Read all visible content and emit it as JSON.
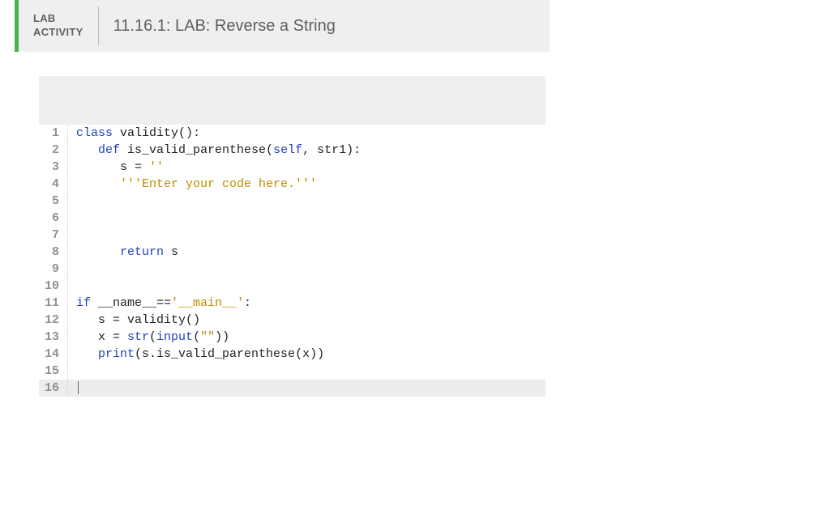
{
  "header": {
    "badge_line1": "LAB",
    "badge_line2": "ACTIVITY",
    "title": "11.16.1: LAB: Reverse a String"
  },
  "editor": {
    "lines": [
      {
        "n": 1,
        "hl": false,
        "tokens": [
          {
            "t": "class ",
            "c": "tok-kw"
          },
          {
            "t": "validity():",
            "c": "tok-name"
          }
        ]
      },
      {
        "n": 2,
        "hl": false,
        "tokens": [
          {
            "t": "   ",
            "c": ""
          },
          {
            "t": "def ",
            "c": "tok-kw"
          },
          {
            "t": "is_valid_parenthese(",
            "c": "tok-name"
          },
          {
            "t": "self",
            "c": "tok-self"
          },
          {
            "t": ", str1):",
            "c": "tok-name"
          }
        ]
      },
      {
        "n": 3,
        "hl": false,
        "tokens": [
          {
            "t": "      s = ",
            "c": "tok-var"
          },
          {
            "t": "''",
            "c": "tok-str"
          }
        ]
      },
      {
        "n": 4,
        "hl": false,
        "tokens": [
          {
            "t": "      ",
            "c": ""
          },
          {
            "t": "'''Enter your code here.'''",
            "c": "tok-str"
          }
        ]
      },
      {
        "n": 5,
        "hl": false,
        "tokens": [
          {
            "t": "",
            "c": ""
          }
        ]
      },
      {
        "n": 6,
        "hl": false,
        "tokens": [
          {
            "t": "",
            "c": ""
          }
        ]
      },
      {
        "n": 7,
        "hl": false,
        "tokens": [
          {
            "t": "",
            "c": ""
          }
        ]
      },
      {
        "n": 8,
        "hl": false,
        "tokens": [
          {
            "t": "      ",
            "c": ""
          },
          {
            "t": "return ",
            "c": "tok-kw"
          },
          {
            "t": "s",
            "c": "tok-var"
          }
        ]
      },
      {
        "n": 9,
        "hl": false,
        "tokens": [
          {
            "t": "",
            "c": ""
          }
        ]
      },
      {
        "n": 10,
        "hl": false,
        "tokens": [
          {
            "t": "",
            "c": ""
          }
        ]
      },
      {
        "n": 11,
        "hl": false,
        "tokens": [
          {
            "t": "if ",
            "c": "tok-kw"
          },
          {
            "t": "__name__==",
            "c": "tok-var"
          },
          {
            "t": "'__main__'",
            "c": "tok-str"
          },
          {
            "t": ":",
            "c": "tok-var"
          }
        ]
      },
      {
        "n": 12,
        "hl": false,
        "tokens": [
          {
            "t": "   s = validity()",
            "c": "tok-var"
          }
        ]
      },
      {
        "n": 13,
        "hl": false,
        "tokens": [
          {
            "t": "   x = ",
            "c": "tok-var"
          },
          {
            "t": "str",
            "c": "tok-kw"
          },
          {
            "t": "(",
            "c": "tok-var"
          },
          {
            "t": "input",
            "c": "tok-kw"
          },
          {
            "t": "(",
            "c": "tok-var"
          },
          {
            "t": "\"\"",
            "c": "tok-str"
          },
          {
            "t": "))",
            "c": "tok-var"
          }
        ]
      },
      {
        "n": 14,
        "hl": false,
        "tokens": [
          {
            "t": "   ",
            "c": ""
          },
          {
            "t": "print",
            "c": "tok-kw"
          },
          {
            "t": "(s.is_valid_parenthese(x))",
            "c": "tok-var"
          }
        ]
      },
      {
        "n": 15,
        "hl": false,
        "tokens": [
          {
            "t": "",
            "c": ""
          }
        ]
      },
      {
        "n": 16,
        "hl": true,
        "tokens": [
          {
            "t": "",
            "c": ""
          }
        ],
        "cursor": true
      }
    ]
  }
}
